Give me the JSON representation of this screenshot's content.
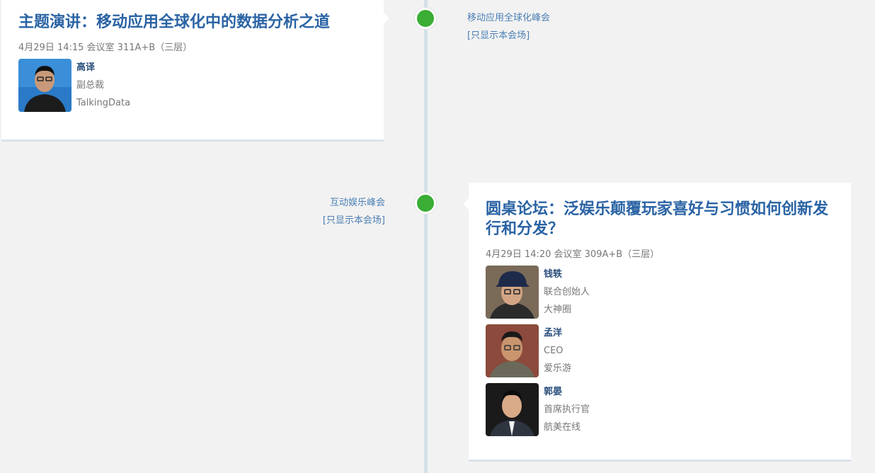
{
  "sessions": [
    {
      "title": "主题演讲：移动应用全球化中的数据分析之道",
      "meta": "4月29日 14:15 会议室 311A+B（三层）",
      "venue": "移动应用全球化峰会",
      "venue_filter": "[只显示本会场]",
      "speakers": [
        {
          "name": "高译",
          "title": "副总裁",
          "org": "TalkingData"
        }
      ]
    },
    {
      "title": "圆桌论坛：泛娱乐颠覆玩家喜好与习惯如何创新发行和分发？",
      "meta": "4月29日 14:20 会议室 309A+B（三层）",
      "venue": "互动娱乐峰会",
      "venue_filter": "[只显示本会场]",
      "speakers": [
        {
          "name": "钱轶",
          "title": "联合创始人",
          "org": "大神圈"
        },
        {
          "name": "孟洋",
          "title": "CEO",
          "org": "爱乐游"
        },
        {
          "name": "郭晏",
          "title": "首席执行官",
          "org": "航美在线"
        }
      ]
    }
  ],
  "colors": {
    "accent": "#2a63a4",
    "dot": "#3aad35",
    "line": "#d3e0ea"
  }
}
